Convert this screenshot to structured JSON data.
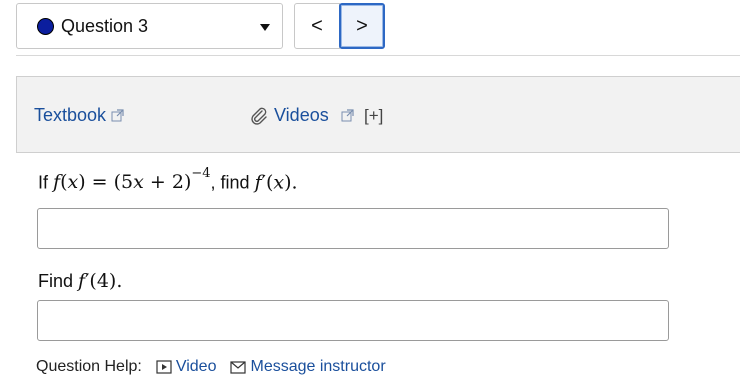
{
  "question_nav": {
    "current_label": "Question 3",
    "prev_symbol": "<",
    "next_symbol": ">",
    "status_color": "#0b1e9e"
  },
  "resources": {
    "textbook_label": "Textbook",
    "videos_label": "Videos",
    "expand_label": "[+]"
  },
  "question1": {
    "prefix": "If",
    "f": "f",
    "x": "x",
    "base": "(5",
    "base2": " + 2)",
    "exponent": "−4",
    "middle": ", find",
    "fprime": "f",
    "prime": "′",
    "argx": "(",
    "argx2": ")",
    "end": "."
  },
  "question2": {
    "prefix": "Find",
    "f": "f",
    "prime": "′",
    "arg": "(4)",
    "end": "."
  },
  "answers": {
    "a1_value": "",
    "a2_value": ""
  },
  "help": {
    "label": "Question Help:",
    "video_label": "Video",
    "message_label": "Message instructor"
  }
}
